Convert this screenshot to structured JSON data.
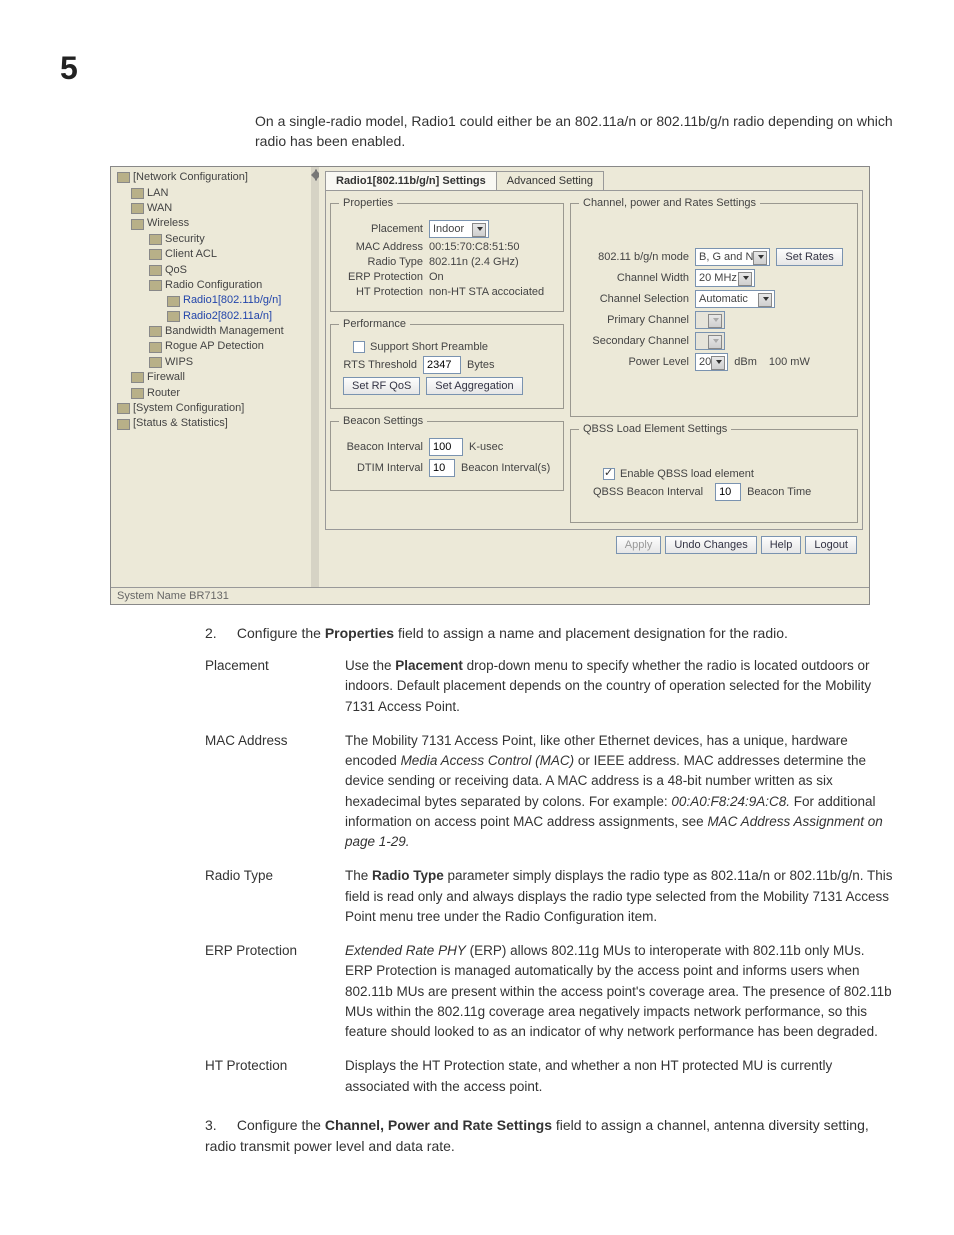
{
  "page_number": "5",
  "intro": "On a single-radio model, Radio1 could either be an 802.11a/n or 802.11b/g/n radio depending on which radio has been enabled.",
  "tree": [
    {
      "label": "[Network Configuration]",
      "depth": 0,
      "link": false,
      "icon": "network-icon"
    },
    {
      "label": "LAN",
      "depth": 1,
      "link": false,
      "icon": "lan-icon"
    },
    {
      "label": "WAN",
      "depth": 1,
      "link": false,
      "icon": "wan-icon"
    },
    {
      "label": "Wireless",
      "depth": 1,
      "link": false,
      "icon": "wireless-icon"
    },
    {
      "label": "Security",
      "depth": 2,
      "link": false,
      "icon": "security-icon"
    },
    {
      "label": "Client ACL",
      "depth": 2,
      "link": false,
      "icon": "client-icon"
    },
    {
      "label": "QoS",
      "depth": 2,
      "link": false,
      "icon": "qos-icon"
    },
    {
      "label": "Radio Configuration",
      "depth": 2,
      "link": false,
      "icon": "radio-config-icon"
    },
    {
      "label": "Radio1[802.11b/g/n]",
      "depth": 3,
      "link": true,
      "icon": "radio-icon"
    },
    {
      "label": "Radio2[802.11a/n]",
      "depth": 3,
      "link": true,
      "icon": "radio-icon"
    },
    {
      "label": "Bandwidth Management",
      "depth": 2,
      "link": false,
      "icon": "bandwidth-icon"
    },
    {
      "label": "Rogue AP Detection",
      "depth": 2,
      "link": false,
      "icon": "rogue-icon"
    },
    {
      "label": "WIPS",
      "depth": 2,
      "link": false,
      "icon": "wips-icon"
    },
    {
      "label": "Firewall",
      "depth": 1,
      "link": false,
      "icon": "firewall-icon"
    },
    {
      "label": "Router",
      "depth": 1,
      "link": false,
      "icon": "router-icon"
    },
    {
      "label": "[System Configuration]",
      "depth": 0,
      "link": false,
      "icon": "system-icon"
    },
    {
      "label": "[Status & Statistics]",
      "depth": 0,
      "link": false,
      "icon": "stats-icon"
    }
  ],
  "tabs": {
    "active": "Radio1[802.11b/g/n] Settings",
    "other": "Advanced Setting"
  },
  "properties": {
    "legend": "Properties",
    "placement_label": "Placement",
    "placement_value": "Indoor",
    "mac_label": "MAC Address",
    "mac_value": "00:15:70:C8:51:50",
    "radio_type_label": "Radio Type",
    "radio_type_value": "802.11n (2.4 GHz)",
    "erp_label": "ERP Protection",
    "erp_value": "On",
    "ht_label": "HT Protection",
    "ht_value": "non-HT STA accociated"
  },
  "performance": {
    "legend": "Performance",
    "short_preamble": "Support Short Preamble",
    "rts_label": "RTS Threshold",
    "rts_value": "2347",
    "rts_unit": "Bytes",
    "set_rf_qos": "Set RF QoS",
    "set_aggregation": "Set Aggregation"
  },
  "beacon": {
    "legend": "Beacon Settings",
    "interval_label": "Beacon Interval",
    "interval_value": "100",
    "interval_unit": "K-usec",
    "dtim_label": "DTIM Interval",
    "dtim_value": "10",
    "dtim_unit": "Beacon Interval(s)"
  },
  "channel": {
    "legend": "Channel, power and Rates Settings",
    "mode_label": "802.11 b/g/n mode",
    "mode_value": "B, G and N",
    "set_rates": "Set Rates",
    "width_label": "Channel Width",
    "width_value": "20 MHz",
    "selection_label": "Channel Selection",
    "selection_value": "Automatic",
    "primary_label": "Primary Channel",
    "primary_value": "",
    "secondary_label": "Secondary Channel",
    "secondary_value": "",
    "power_label": "Power Level",
    "power_value": "20",
    "power_unit1": "dBm",
    "power_unit2": "100  mW"
  },
  "qbss": {
    "legend": "QBSS Load Element Settings",
    "enable": "Enable QBSS load element",
    "interval_label": "QBSS Beacon Interval",
    "interval_value": "10",
    "interval_unit": "Beacon Time"
  },
  "actions": {
    "apply": "Apply",
    "undo": "Undo Changes",
    "help": "Help",
    "logout": "Logout"
  },
  "status_bar": "System Name BR7131",
  "step2_prefix": "Configure the ",
  "step2_bold": "Properties",
  "step2_suffix": " field to assign a name and placement designation for the radio.",
  "defs": [
    {
      "term": "Placement",
      "desc_a": "Use the ",
      "desc_b": "Placement",
      "desc_c": " drop-down menu to specify whether the radio is located outdoors or indoors. Default placement depends on the country of operation selected for the Mobility 7131 Access Point."
    },
    {
      "term": "MAC Address",
      "desc_a": "The Mobility 7131 Access Point, like other Ethernet devices, has a unique, hardware encoded ",
      "desc_i1": "Media Access Control (MAC)",
      "desc_c": " or IEEE address. MAC addresses determine the device sending or receiving data. A MAC address is a 48-bit number written as six hexadecimal bytes separated by colons. For example: ",
      "desc_i2": "00:A0:F8:24:9A:C8.",
      "desc_d": " For additional information on access point MAC address assignments, see ",
      "desc_i3": "MAC Address Assignment on page 1-29."
    },
    {
      "term": "Radio Type",
      "desc_a": "The ",
      "desc_b": "Radio Type",
      "desc_c": " parameter simply displays the radio type as 802.11a/n or 802.11b/g/n. This field is read only and always displays the radio type selected from the Mobility 7131 Access Point menu tree under the Radio Configuration item."
    },
    {
      "term": "ERP Protection",
      "desc_i1": "Extended Rate PHY",
      "desc_c": " (ERP) allows 802.11g MUs to interoperate with 802.11b only MUs. ERP Protection is managed automatically by the access point and informs users when 802.11b MUs are present within the access point's coverage area. The presence of 802.11b MUs within the 802.11g coverage area negatively impacts network performance, so this feature should looked to as an indicator of why network performance has been degraded."
    },
    {
      "term": "HT Protection",
      "desc_c": "Displays the HT Protection state, and whether a non HT protected MU is currently associated with the access point."
    }
  ],
  "step3_prefix": "Configure the ",
  "step3_bold": "Channel, Power and Rate Settings",
  "step3_suffix": " field to assign a channel, antenna diversity setting, radio transmit power level and data rate."
}
